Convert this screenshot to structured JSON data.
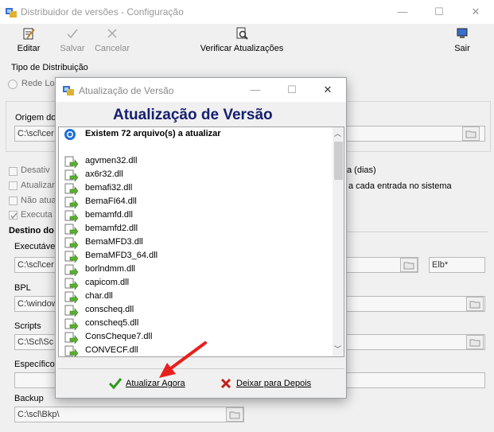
{
  "window": {
    "title": "Distribuidor de versões - Configuração",
    "min_glyph": "—",
    "max_glyph": "☐",
    "close_glyph": "✕"
  },
  "toolbar": {
    "editar": "Editar",
    "salvar": "Salvar",
    "cancelar": "Cancelar",
    "verificar": "Verificar Atualizações",
    "sair": "Sair"
  },
  "tipo": {
    "group_label": "Tipo de Distribuição",
    "radio_label": "Rede Loc"
  },
  "origem": {
    "label": "Origem do",
    "value": "C:\\scl\\cer"
  },
  "options": {
    "desativ": "Desativ",
    "atualizar": "Atualizar",
    "nao_atua": "Não atua",
    "executa": "Executa",
    "dias_text": "a (dias)",
    "entrada_text": "a cada entrada no sistema"
  },
  "destino": {
    "group_label": "Destino do",
    "executavel_label": "Executáve",
    "executavel_value": "C:\\scl\\cer",
    "ext_value": "Elb*",
    "bpl_label": "BPL",
    "bpl_value": "C:\\window",
    "scripts_label": "Scripts",
    "scripts_value": "C:\\Scl\\Sc",
    "especifico_label": "Específico",
    "especifico_value": "",
    "backup_label": "Backup",
    "backup_value": "C:\\scl\\Bkp\\"
  },
  "dialog": {
    "title": "Atualização de Versão",
    "heading": "Atualização de Versão",
    "count_text": "Existem 72 arquivo(s) a atualizar",
    "files": [
      "agvmen32.dll",
      "ax6r32.dll",
      "bemafi32.dll",
      "BemaFI64.dll",
      "bemamfd.dll",
      "bemamfd2.dll",
      "BemaMFD3.dll",
      "BemaMFD3_64.dll",
      "borlndmm.dll",
      "capicom.dll",
      "char.dll",
      "conscheq.dll",
      "conscheq5.dll",
      "ConsCheque7.dll",
      "CONVECF.dll"
    ],
    "btn_update": "Atualizar Agora",
    "btn_later": "Deixar para Depois",
    "scroll_up": "︿",
    "scroll_down": "﹀"
  },
  "colors": {
    "heading": "#16206e",
    "arrow": "#e8201c",
    "check": "#2e9a1e",
    "cross": "#c0201a"
  }
}
